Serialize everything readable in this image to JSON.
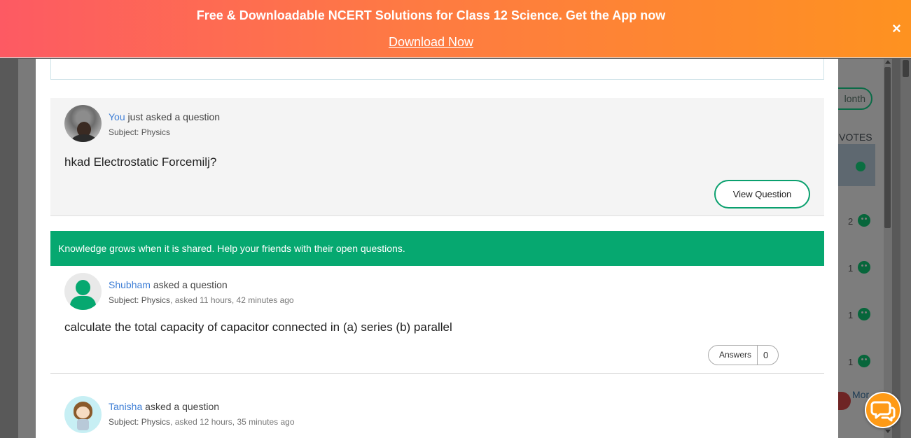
{
  "promo_banner": {
    "text": "Free & Downloadable NCERT Solutions for Class 12 Science. Get the App now",
    "link": "Download Now",
    "close": "×"
  },
  "background": {
    "pill_label": "lonth",
    "votes_header": "L VOTES",
    "vote_counts": [
      "2",
      "1",
      "1",
      "1"
    ],
    "more_link": "Mor"
  },
  "own_question": {
    "asker": "You",
    "action": "just asked a question",
    "subject": "Subject: Physics",
    "text": "hkad Electrostatic Forcemilj?",
    "button": "View Question"
  },
  "share_banner": "Knowledge grows when it is shared. Help your friends with their open questions.",
  "questions": [
    {
      "asker": "Shubham",
      "action": "asked a question",
      "subject": "Subject: Physics",
      "time": ", asked 11 hours, 42 minutes ago",
      "text": "calculate the total capacity of capacitor connected in (a) series (b) parallel",
      "answers_label": "Answers",
      "answers_count": "0"
    },
    {
      "asker": "Tanisha",
      "action": "asked a question",
      "subject": "Subject: Physics",
      "time": ", asked 12 hours, 35 minutes ago"
    }
  ],
  "colors": {
    "accent_green": "#06a870",
    "link_blue": "#3f7fd6",
    "banner_start": "#fd5a63",
    "banner_end": "#fe9220",
    "chat_orange": "#fe9a16"
  },
  "icons": {
    "close": "close-icon",
    "chat": "chat-bubbles-icon",
    "default_avatar": "user-silhouette-icon"
  }
}
